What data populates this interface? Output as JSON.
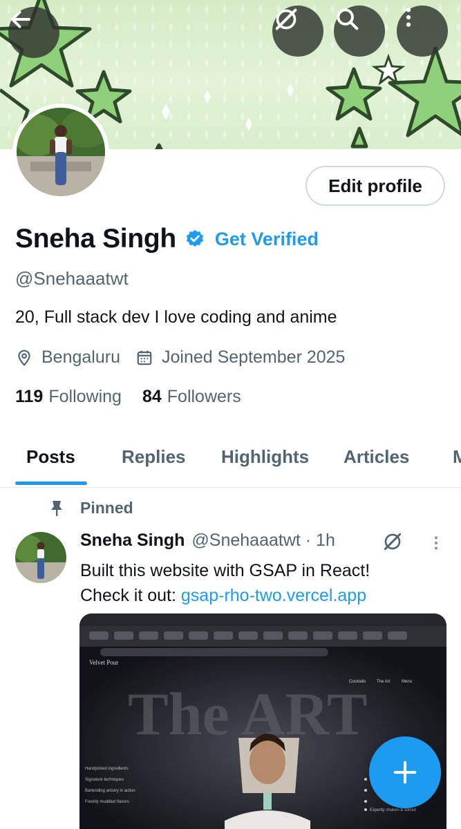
{
  "profile": {
    "name": "Sneha Singh",
    "get_verified": "Get Verified",
    "handle": "@Snehaaatwt",
    "bio": "20, Full stack dev I love coding and anime",
    "location": "Bengaluru",
    "joined": "Joined September 2025",
    "following_count": "119",
    "following_label": "Following",
    "followers_count": "84",
    "followers_label": "Followers",
    "edit_profile": "Edit profile"
  },
  "tabs": [
    {
      "label": "Posts",
      "active": true
    },
    {
      "label": "Replies",
      "active": false
    },
    {
      "label": "Highlights",
      "active": false
    },
    {
      "label": "Articles",
      "active": false
    },
    {
      "label": "M",
      "active": false
    }
  ],
  "post": {
    "pinned_label": "Pinned",
    "author_name": "Sneha Singh",
    "author_meta": "@Snehaaatwt · 1h",
    "text_line1": "Built this website with GSAP in React!",
    "text_prefix": "Check it out: ",
    "link": "gsap-rho-two.vercel.app",
    "media": {
      "brand": "Velvet Pour",
      "nav_cocktails": "Cocktails",
      "nav_art": "The Art",
      "nav_menu": "Menu",
      "headline": "The ART",
      "list_left": [
        "Handpicked ingredients",
        "Signature techniques",
        "Bartending artistry in action",
        "Freshly muddled flavors"
      ],
      "list_right": [
        "Expertly shaken & stirred"
      ]
    }
  },
  "colors": {
    "accent": "#1d9bf0",
    "text_primary": "#0f1419",
    "text_secondary": "#536471",
    "banner_star": "#8fd17a"
  },
  "icons": {
    "back": "arrow-left-icon",
    "grok": "grok-icon",
    "search": "search-icon",
    "more": "more-vertical-icon",
    "location": "location-pin-icon",
    "calendar": "calendar-icon",
    "pin": "pin-icon",
    "compose": "plus-icon"
  }
}
